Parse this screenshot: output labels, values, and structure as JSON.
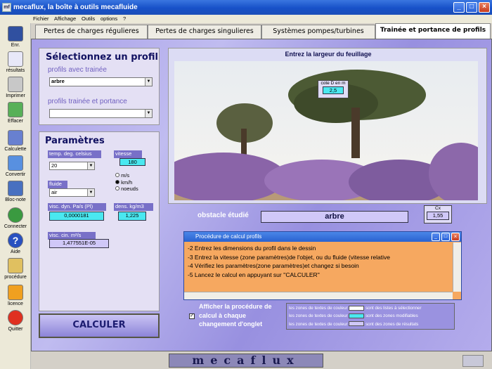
{
  "window": {
    "title": "mecaflux, la boîte à outils mecafluide",
    "icon_text": "mf"
  },
  "menu": [
    "Fichier",
    "Affichage",
    "Outils",
    "options",
    "?"
  ],
  "sidebar": [
    "Enr.",
    "résultats",
    "Imprimer",
    "Effacer",
    "Calculette",
    "Convertir",
    "Bloc-note",
    "Connecter",
    "Aide",
    "procédure",
    "licence",
    "Quitter"
  ],
  "tabs": [
    "Pertes de charges régulieres",
    "Pertes de charges singulieres",
    "Systèmes pompes/turbines",
    "Trainée et portance de profils"
  ],
  "profile": {
    "title": "Sélectionnez un profil",
    "drag_label": "profils avec trainée",
    "drag_value": "arbre",
    "lift_label": "profils trainée et portance",
    "lift_value": ""
  },
  "params": {
    "title": "Paramètres",
    "temp_label": "temp. deg. celsius",
    "temp_value": "20",
    "speed_label": "vitesse",
    "speed_value": "180",
    "units": [
      "m/s",
      "km/h",
      "noeuds"
    ],
    "selected_unit": "km/h",
    "fluid_label": "fluide",
    "fluid_value": "air",
    "dyn_visc_label": "visc. dyn. Pa/s (Pl)",
    "dyn_visc_value": "0,0000181",
    "density_label": "dens. kg/m3",
    "density_value": "1,225",
    "kin_visc_label": "visc. cin. m²/s",
    "kin_visc_value": "1,477551E-05"
  },
  "calculate_label": "CALCULER",
  "image_area": {
    "title": "Entrez la largeur du feuillage",
    "dim_label": "cote D en m",
    "dim_value": "2,5"
  },
  "obstacle": {
    "label": "obstacle étudié",
    "value": "arbre",
    "cx_label": "Cx",
    "cx_value": "1,55"
  },
  "procedure": {
    "title": "Procédure de calcul profils",
    "lines": [
      "-2 Entrez les dimensions du profil dans le dessin",
      "-3 Entrez la vitesse (zone paramètres)de l'objet, ou du fluide (vitesse relative",
      "-4 Vérifiez les paramètres(zone paramètres)et changez si besoin",
      "-5 Lancez le calcul en appuyant sur ''CALCULER''"
    ]
  },
  "auto_display": {
    "label": "Afficher la procédure de calcul à chaque changement d'onglet",
    "checked": true
  },
  "legend": [
    {
      "left": "les zones de textes de couleur",
      "color": "#ffffff",
      "right": "sont des listes à sélectionner"
    },
    {
      "left": "les zones de textes de couleur",
      "color": "#4ae8f0",
      "right": "sont des zones modifiables"
    },
    {
      "left": "les zones de textes de couleur",
      "color": "#d0c8f8",
      "right": "sont des zones de résultats"
    }
  ],
  "brand": "mecaflux"
}
